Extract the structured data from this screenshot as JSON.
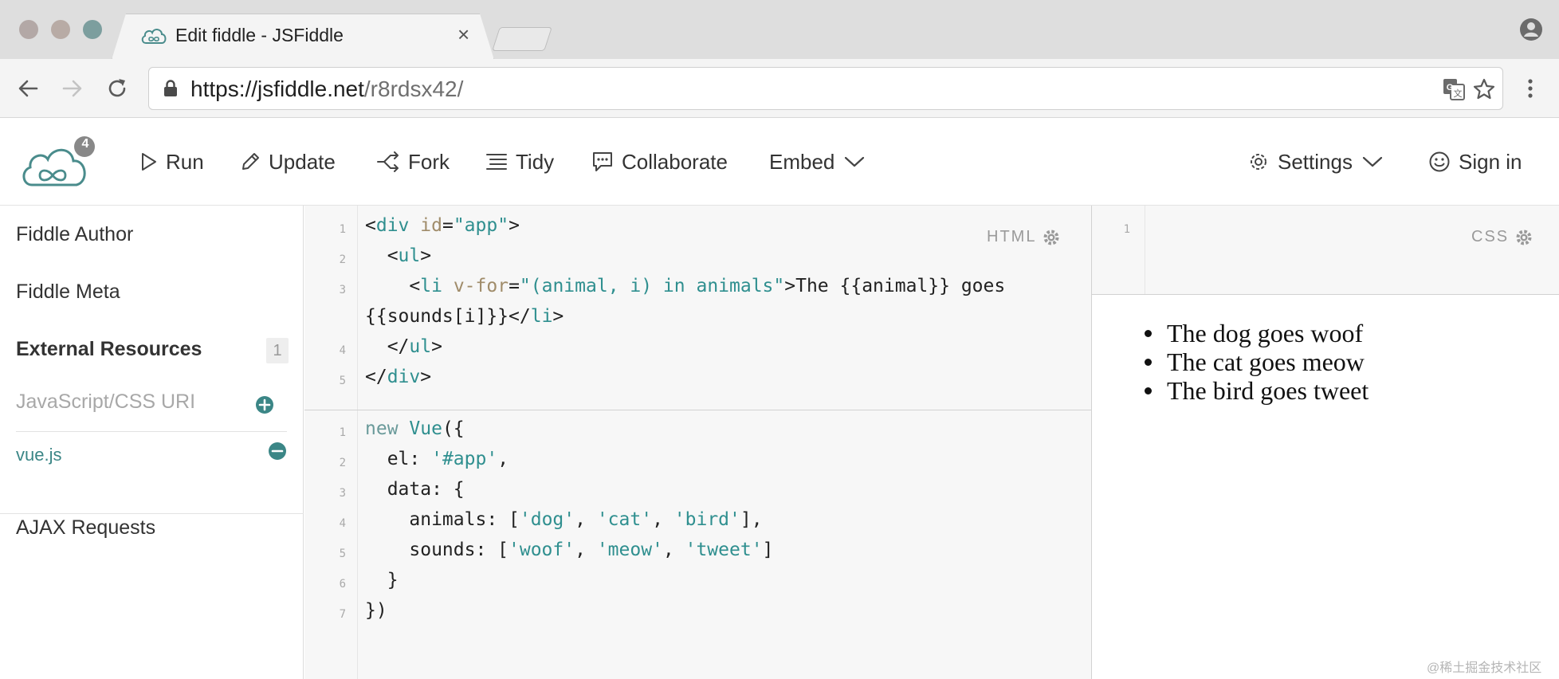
{
  "browser": {
    "tab_title": "Edit fiddle - JSFiddle",
    "tab_close": "×",
    "url_scheme_host": "https://jsfiddle.net",
    "url_path": "/r8rdsx42/"
  },
  "app": {
    "logo_badge": "4",
    "toolbar": {
      "run": "Run",
      "update": "Update",
      "fork": "Fork",
      "tidy": "Tidy",
      "collaborate": "Collaborate",
      "embed": "Embed",
      "settings": "Settings",
      "sign_in": "Sign in"
    }
  },
  "sidebar": {
    "fiddle_author": "Fiddle Author",
    "fiddle_meta": "Fiddle Meta",
    "external_resources": "External Resources",
    "external_resources_count": "1",
    "uri_placeholder": "JavaScript/CSS URI",
    "resource": "vue.js",
    "ajax_requests": "AJAX Requests"
  },
  "html_panel": {
    "label": "HTML",
    "line_numbers": [
      "1",
      "2",
      "3",
      "4",
      "5"
    ],
    "lines": [
      "<div id=\"app\">",
      "  <ul>",
      "    <li v-for=\"(animal, i) in animals\">The {{animal}} goes",
      "{{sounds[i]}}</li>",
      "  </ul>",
      "</div>"
    ]
  },
  "css_panel": {
    "label": "CSS",
    "line_numbers": [
      "1"
    ]
  },
  "js_panel": {
    "line_numbers": [
      "1",
      "2",
      "3",
      "4",
      "5",
      "6",
      "7"
    ],
    "lines": [
      "new Vue({",
      "  el: '#app',",
      "  data: {",
      "    animals: ['dog', 'cat', 'bird'],",
      "    sounds: ['woof', 'meow', 'tweet']",
      "  }",
      "})"
    ]
  },
  "result": {
    "items": [
      "The dog goes woof",
      "The cat goes meow",
      "The bird goes tweet"
    ]
  },
  "watermark": "@稀土掘金技术社区",
  "colors": {
    "accent": "#3b8686",
    "code_tag": "#2f8f8f",
    "code_attr": "#a08c6a",
    "editor_bg": "#f7f7f7"
  }
}
